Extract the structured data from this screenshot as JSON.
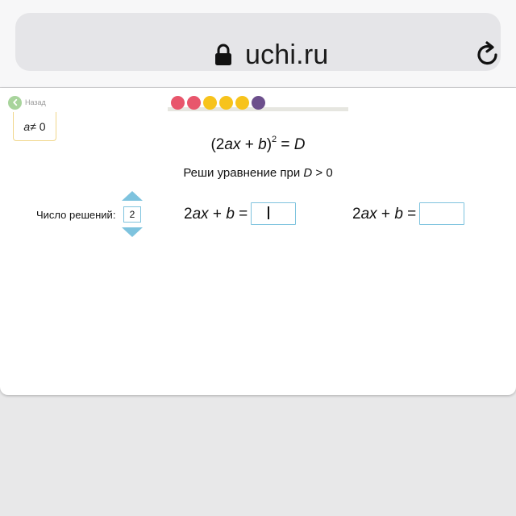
{
  "browser": {
    "url_text": "uchi.ru",
    "icons": [
      "lock-icon",
      "reload-icon"
    ]
  },
  "nav": {
    "back_label": "Назад",
    "back_icon": "chevron-left-icon",
    "back_icon_color": "#a8d49c"
  },
  "condition": {
    "var": "a",
    "rest": " ≠ 0"
  },
  "progress": {
    "dot_colors": [
      "#e8566c",
      "#e8566c",
      "#f7c31c",
      "#f7c31c",
      "#f7c31c",
      "#6c4f8c"
    ]
  },
  "equation": {
    "open": "(2",
    "ax": "ax",
    "plus": " + ",
    "b": "b",
    "close": ")",
    "power": "2",
    "equals": " = ",
    "D": "D"
  },
  "instruction": {
    "text": "Реши уравнение при ",
    "D": "D",
    "rest": " > 0"
  },
  "solutions": {
    "count_label": "Число решений:",
    "count_value": "2",
    "stepper_color": "#7ec3de",
    "rows": [
      {
        "lhs_num": "2",
        "lhs_ax": "ax",
        "plus": " + ",
        "lhs_b": "b",
        "equals": " =",
        "value": ""
      },
      {
        "lhs_num": "2",
        "lhs_ax": "ax",
        "plus": " + ",
        "lhs_b": "b",
        "equals": " =",
        "value": ""
      }
    ]
  }
}
